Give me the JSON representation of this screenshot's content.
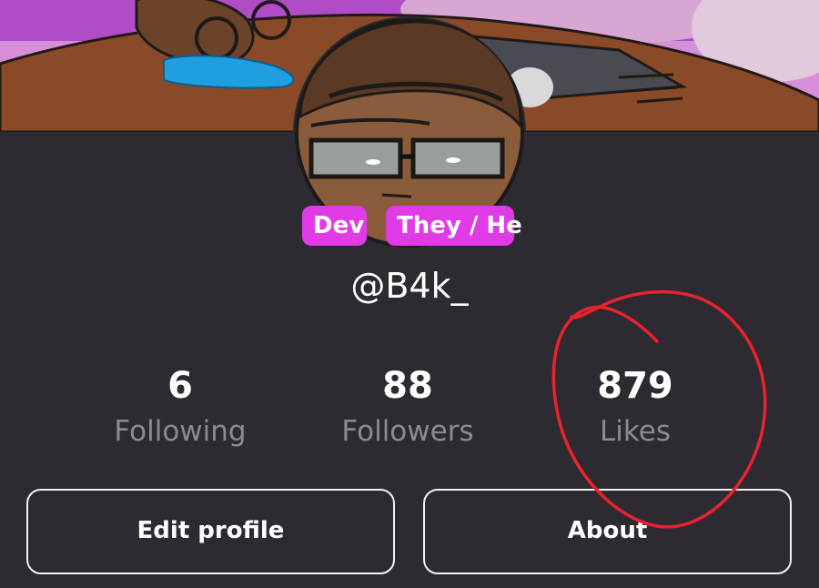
{
  "profile": {
    "username": "@B4k_",
    "tags": [
      "Dev",
      "They / He"
    ]
  },
  "stats": {
    "following": {
      "value": "6",
      "label": "Following"
    },
    "followers": {
      "value": "88",
      "label": "Followers"
    },
    "likes": {
      "value": "879",
      "label": "Likes"
    }
  },
  "buttons": {
    "edit_profile": "Edit profile",
    "about": "About"
  },
  "colors": {
    "background": "#2d2a31",
    "tag": "#e03be6",
    "annotation": "#e8232d",
    "muted_text": "#8d8a92"
  }
}
